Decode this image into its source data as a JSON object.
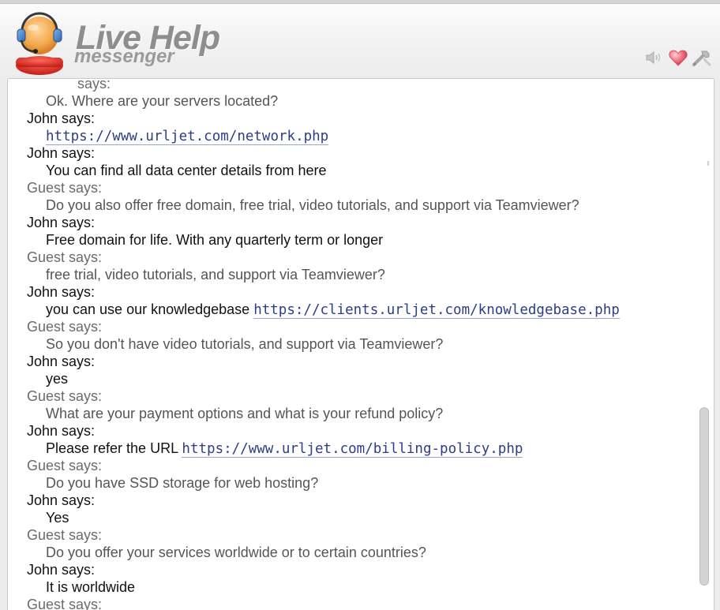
{
  "app": {
    "logo_title": "Live Help",
    "logo_subtitle": "messenger",
    "icons": [
      "speaker-icon",
      "heart-icon",
      "tools-icon"
    ]
  },
  "colors": {
    "link": "#2c3e86",
    "guest": "#6b6b6b",
    "john": "#111111",
    "background": "#ececec"
  },
  "chat": {
    "top_clipped_sender": "says:",
    "messages": [
      {
        "sender": "",
        "text": "Ok. Where are your servers located?",
        "role": "guest"
      },
      {
        "sender": "John says:",
        "text": "",
        "link": "https://www.urljet.com/network.php",
        "role": "john"
      },
      {
        "sender": "John says:",
        "text": "You can find all data center details from here",
        "role": "john"
      },
      {
        "sender": "Guest says:",
        "text": "Do you also offer free domain, free trial, video tutorials, and support via Teamviewer?",
        "role": "guest"
      },
      {
        "sender": "John says:",
        "text": "Free domain for life. With any quarterly term or longer",
        "role": "john"
      },
      {
        "sender": "Guest says:",
        "text": "free trial, video tutorials, and support via Teamviewer?",
        "role": "guest"
      },
      {
        "sender": "John says:",
        "text": "you can use our knowledgebase ",
        "link": "https://clients.urljet.com/knowledgebase.php",
        "role": "john"
      },
      {
        "sender": "Guest says:",
        "text": "So you don't have video tutorials, and support via Teamviewer?",
        "role": "guest"
      },
      {
        "sender": "John says:",
        "text": "yes",
        "role": "john"
      },
      {
        "sender": "Guest says:",
        "text": "What are your payment options and what is your refund policy?",
        "role": "guest"
      },
      {
        "sender": "John says:",
        "text": "Please refer the URL ",
        "link": "https://www.urljet.com/billing-policy.php",
        "role": "john"
      },
      {
        "sender": "Guest says:",
        "text": "Do you have SSD storage for web hosting?",
        "role": "guest"
      },
      {
        "sender": "John says:",
        "text": "Yes",
        "role": "john"
      },
      {
        "sender": "Guest says:",
        "text": "Do you offer your services worldwide or to certain countries?",
        "role": "guest"
      },
      {
        "sender": "John says:",
        "text": "It is worldwide",
        "role": "john"
      },
      {
        "sender": "Guest says:",
        "text": "",
        "role": "guest"
      }
    ]
  }
}
